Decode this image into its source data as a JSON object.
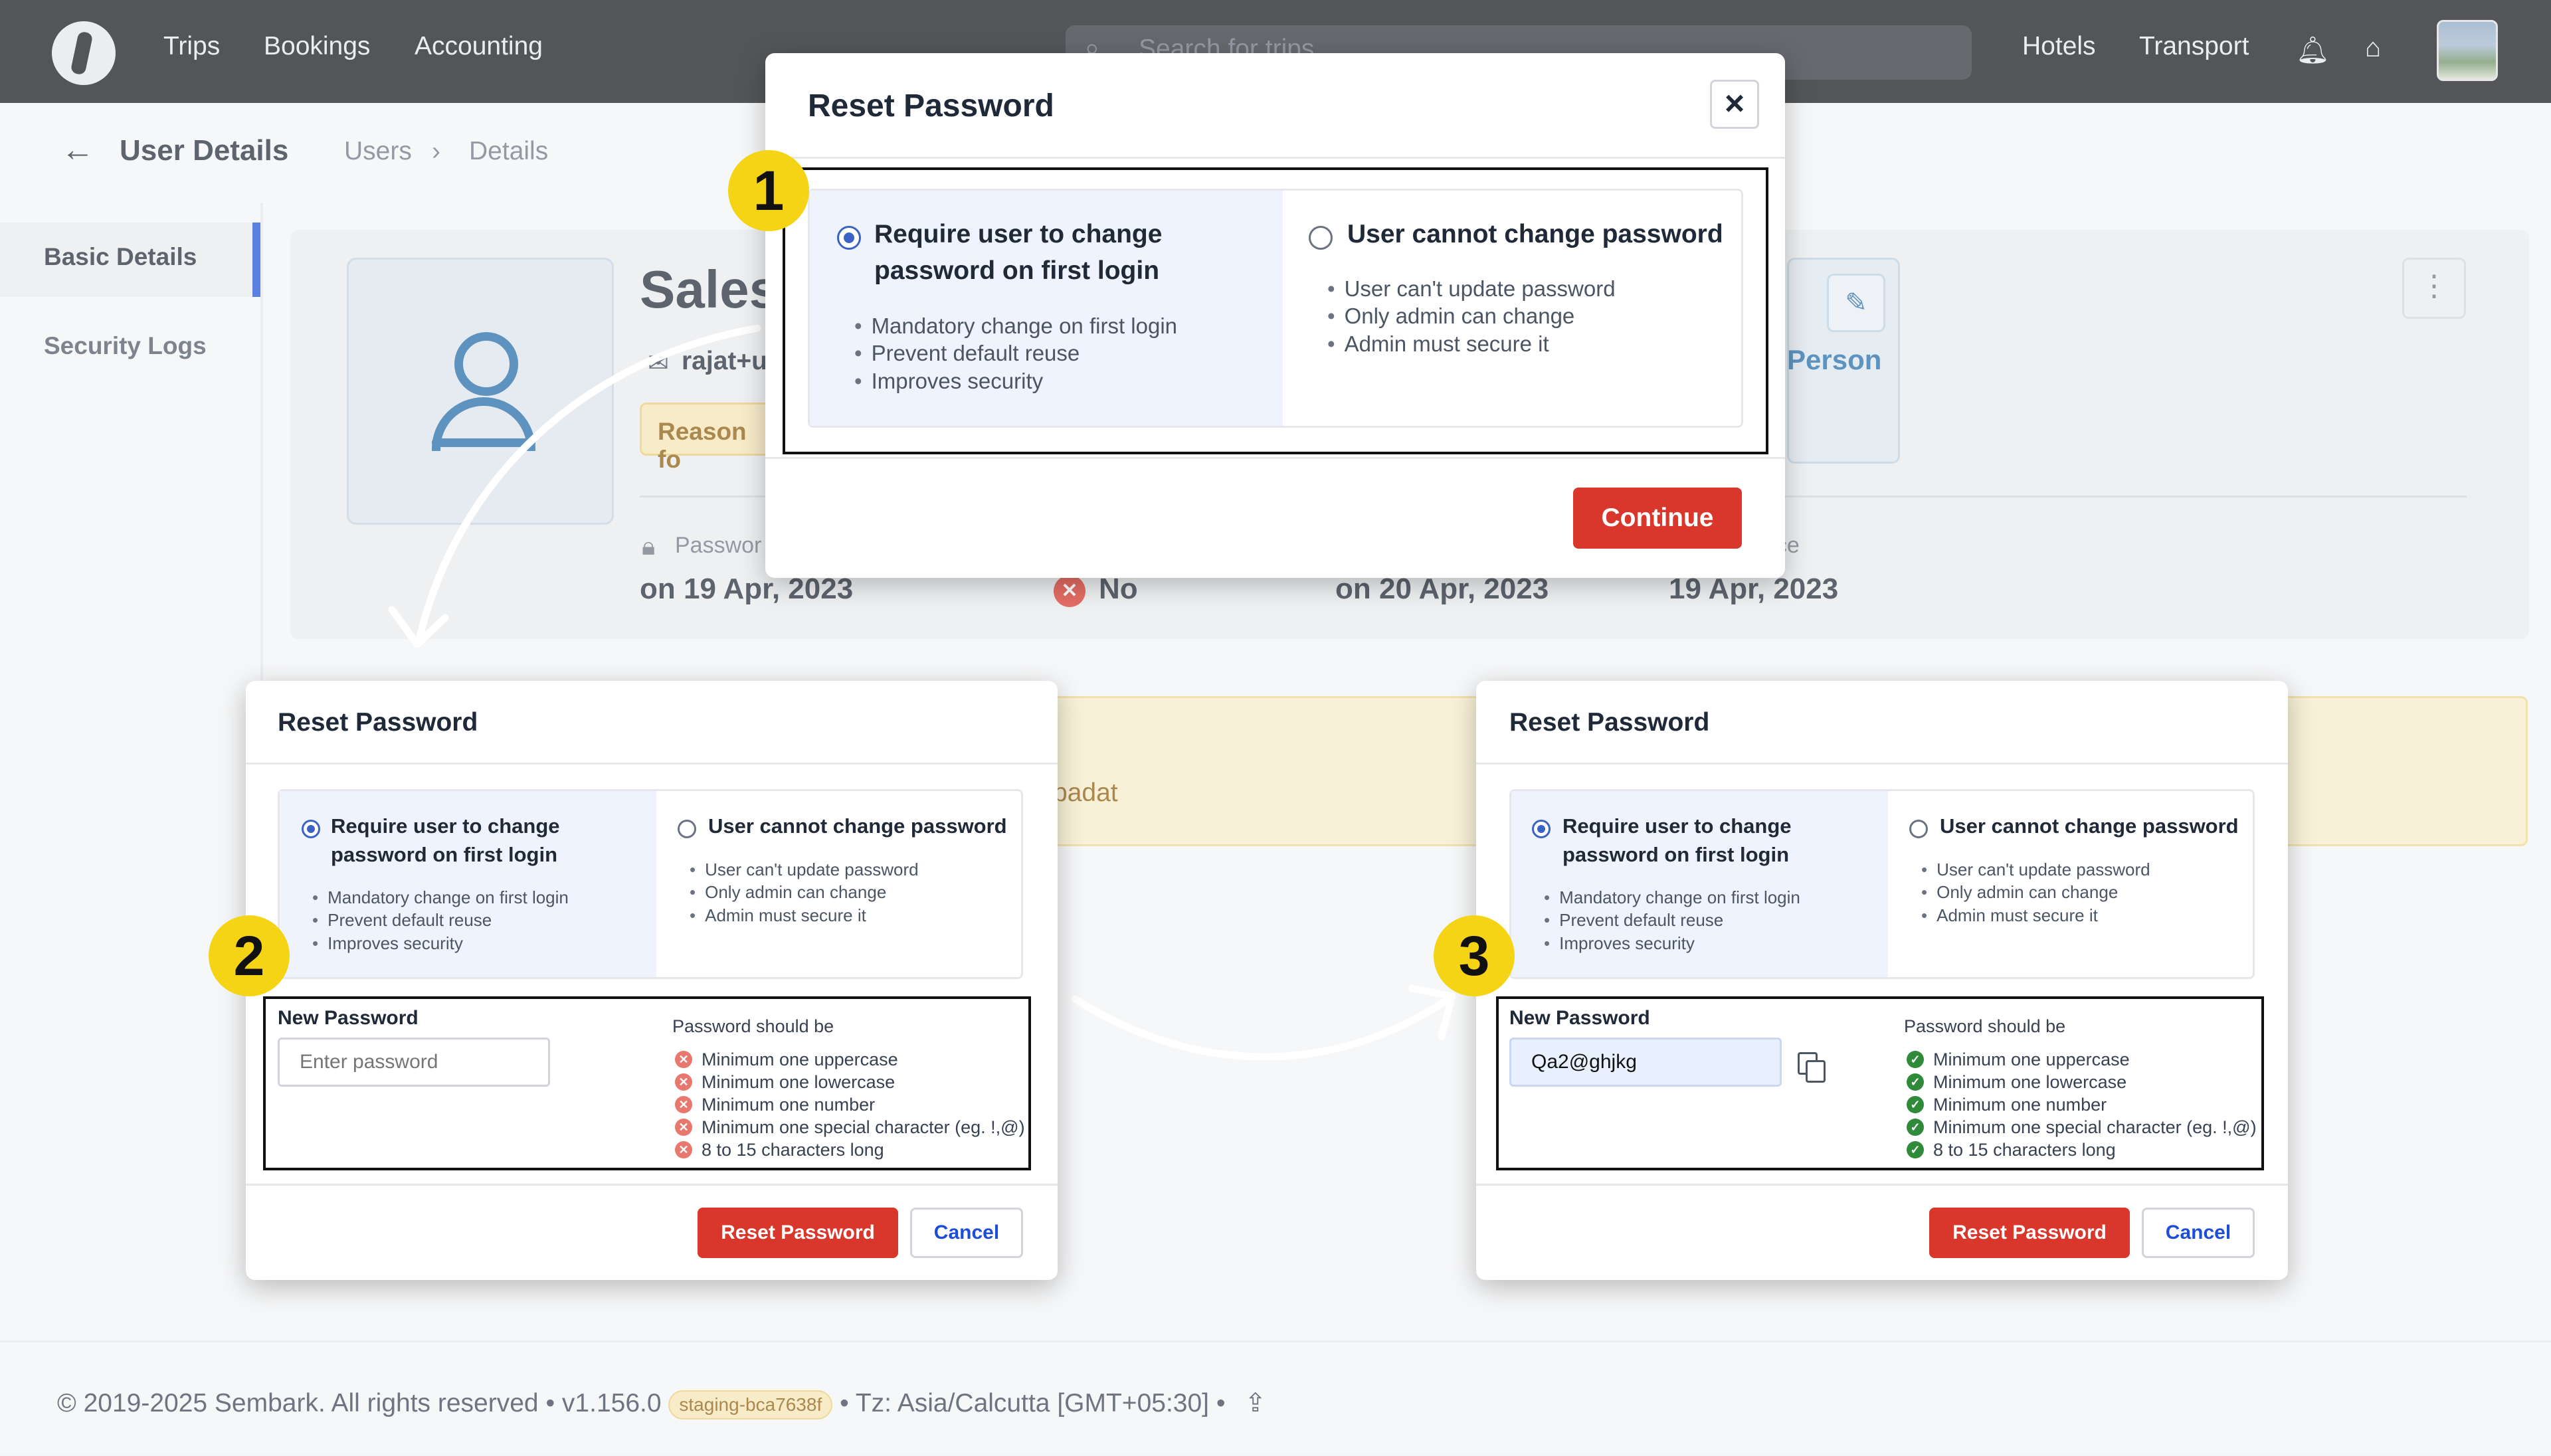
{
  "nav": {
    "items": [
      "Trips",
      "Bookings",
      "Accounting"
    ],
    "search_placeholder": "Search for trips",
    "right_items": [
      "Hotels",
      "Transport"
    ]
  },
  "header": {
    "title": "User Details",
    "breadcrumb": [
      "Users",
      "Details"
    ]
  },
  "sidebar": {
    "items": [
      {
        "label": "Basic Details",
        "active": true
      },
      {
        "label": "Security Logs",
        "active": false
      }
    ]
  },
  "profile": {
    "name_partial": "Sales",
    "email_partial": "rajat+u",
    "reason_partial": "Reason fo",
    "person_label": "Person",
    "meta": [
      {
        "label": "Passwor",
        "value": "on 19 Apr, 2023"
      },
      {
        "label": "",
        "value": "No"
      },
      {
        "label": "",
        "value": "on 20 Apr, 2023"
      },
      {
        "label": "nce",
        "value": "19 Apr, 2023"
      }
    ],
    "warning_partial": "padat"
  },
  "modal1": {
    "badge": "1",
    "title": "Reset Password",
    "close_icon": "close-icon",
    "option_a": {
      "title_line1": "Require user to change",
      "title_line2": "password on first login",
      "bullets": [
        "Mandatory change on first login",
        "Prevent default reuse",
        "Improves security"
      ]
    },
    "option_b": {
      "title": "User cannot change password",
      "bullets": [
        "User can't update password",
        "Only admin can change",
        "Admin must secure it"
      ]
    },
    "continue_label": "Continue"
  },
  "modal2": {
    "badge": "2",
    "title": "Reset Password",
    "new_password_label": "New Password",
    "password_placeholder": "Enter password",
    "password_value": "",
    "rules_title": "Password should be",
    "rules": [
      "Minimum one uppercase",
      "Minimum one lowercase",
      "Minimum one number",
      "Minimum one special character (eg. !,@)",
      "8 to 15 characters long"
    ],
    "reset_label": "Reset Password",
    "cancel_label": "Cancel"
  },
  "modal3": {
    "badge": "3",
    "title": "Reset Password",
    "new_password_label": "New Password",
    "password_value": "Qa2@ghjkg",
    "rules_title": "Password should be",
    "rules": [
      "Minimum one uppercase",
      "Minimum one lowercase",
      "Minimum one number",
      "Minimum one special character (eg. !,@)",
      "8 to 15 characters long"
    ],
    "reset_label": "Reset Password",
    "cancel_label": "Cancel"
  },
  "footer": {
    "copyright": "© 2019-2025 Sembark. All rights reserved • v1.156.0",
    "tag": "staging-bca7638f",
    "timezone": "• Tz: Asia/Calcutta [GMT+05:30] •"
  },
  "colors": {
    "accent_red": "#d9372b",
    "brand_blue": "#1d4ed8",
    "badge_yellow": "#f5d416",
    "rule_fail": "#e8776d",
    "rule_pass": "#2f8a3a"
  }
}
